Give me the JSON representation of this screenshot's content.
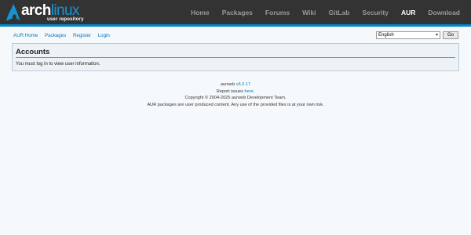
{
  "header": {
    "logo": {
      "brand_dark": "arch",
      "brand_light": "linux",
      "subtitle": "user repository"
    },
    "nav": [
      {
        "label": "Home",
        "active": false
      },
      {
        "label": "Packages",
        "active": false
      },
      {
        "label": "Forums",
        "active": false
      },
      {
        "label": "Wiki",
        "active": false
      },
      {
        "label": "GitLab",
        "active": false
      },
      {
        "label": "Security",
        "active": false
      },
      {
        "label": "AUR",
        "active": true
      },
      {
        "label": "Download",
        "active": false
      }
    ],
    "accent_color": "#08c"
  },
  "subnav": {
    "links": [
      "AUR Home",
      "Packages",
      "Register",
      "Login"
    ],
    "language": {
      "selected": "English",
      "button_label": "Go"
    }
  },
  "main": {
    "title": "Accounts",
    "message": "You must log in to view user information."
  },
  "footer": {
    "version_prefix": "aurweb",
    "version": "v6.2.17",
    "report_prefix": "Report issues",
    "report_link": "here",
    "report_suffix": ".",
    "copyright": "Copyright © 2004-2025 aurweb Development Team.",
    "disclaimer": "AUR packages are user produced content. Any use of the provided files is at your own risk."
  }
}
